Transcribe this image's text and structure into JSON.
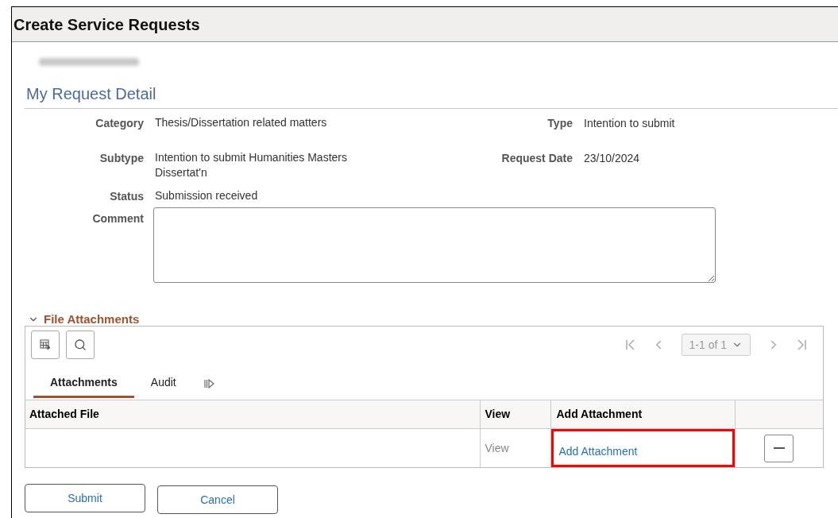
{
  "page": {
    "title": "Create Service Requests",
    "user_name_blurred": true
  },
  "detail": {
    "heading": "My Request Detail",
    "left_fields": [
      {
        "label": "Category",
        "value": "Thesis/Dissertation related matters"
      },
      {
        "label": "Subtype",
        "value": "Intention to submit Humanities Masters Dissertat'n"
      },
      {
        "label": "Status",
        "value": "Submission received"
      }
    ],
    "right_fields": [
      {
        "label": "Type",
        "value": "Intention to submit"
      },
      {
        "label": "Request Date",
        "value": "23/10/2024"
      }
    ],
    "comment": {
      "label": "Comment"
    }
  },
  "attachments": {
    "title": "File Attachments",
    "expanded": true,
    "pager": "1-1 of 1",
    "tabs": [
      {
        "label": "Attachments",
        "selected": true
      },
      {
        "label": "Audit",
        "selected": false
      }
    ],
    "columns": [
      "Attached File",
      "View",
      "Add Attachment"
    ],
    "rows": [
      {
        "view": "View",
        "add_attachment": "Add Attachment",
        "highlighted": true
      }
    ]
  },
  "buttons": [
    "Submit",
    "Cancel"
  ]
}
